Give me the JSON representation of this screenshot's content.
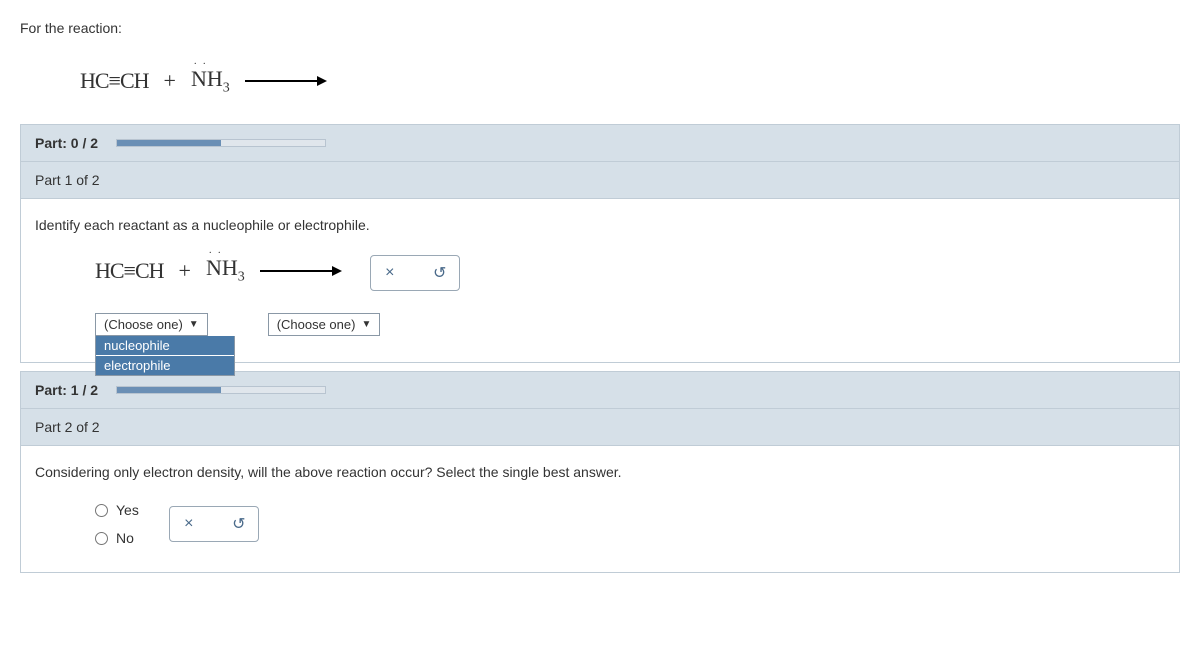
{
  "intro": "For the reaction:",
  "reaction": {
    "reactant1": "HC≡CH",
    "plus": "+",
    "reactant2_base": "NH",
    "reactant2_sub": "3",
    "reactant2_dots": ". ."
  },
  "part_progress": {
    "overall_label": "Part: 0 / 2",
    "overall_fill": "50%",
    "part1_label": "Part 1 of 2",
    "part1_progress_label": "Part: 1 / 2",
    "part1_progress_fill": "50%",
    "part2_label": "Part 2 of 2"
  },
  "part1": {
    "question": "Identify each reactant as a nucleophile or electrophile.",
    "dropdown_placeholder": "(Choose one)",
    "options": [
      "nucleophile",
      "electrophile"
    ]
  },
  "part2": {
    "question": "Considering only electron density, will the above reaction occur? Select the single best answer.",
    "opt_yes": "Yes",
    "opt_no": "No"
  },
  "icons": {
    "close": "×",
    "reset": "↺"
  }
}
